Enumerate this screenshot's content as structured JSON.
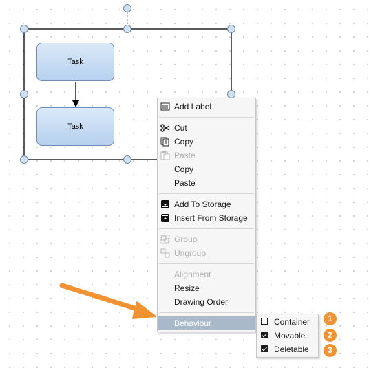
{
  "diagram": {
    "tasks": [
      {
        "label": "Task"
      },
      {
        "label": "Task"
      }
    ]
  },
  "context_menu": {
    "items": [
      {
        "label": "Add Label",
        "icon": "label-icon",
        "enabled": true
      },
      {
        "label": "Cut",
        "icon": "scissors-icon",
        "enabled": true
      },
      {
        "label": "Copy",
        "icon": "copy-icon",
        "enabled": true
      },
      {
        "label": "Paste",
        "icon": "paste-icon",
        "enabled": false
      },
      {
        "label": "Copy",
        "icon": "",
        "enabled": true
      },
      {
        "label": "Paste",
        "icon": "",
        "enabled": true
      },
      {
        "label": "Add To Storage",
        "icon": "storage-add-icon",
        "enabled": true
      },
      {
        "label": "Insert From Storage",
        "icon": "storage-insert-icon",
        "enabled": true
      },
      {
        "label": "Group",
        "icon": "group-icon",
        "enabled": false
      },
      {
        "label": "Ungroup",
        "icon": "ungroup-icon",
        "enabled": false
      },
      {
        "label": "Alignment",
        "icon": "",
        "enabled": false
      },
      {
        "label": "Resize",
        "icon": "",
        "enabled": true
      },
      {
        "label": "Drawing Order",
        "icon": "",
        "enabled": true
      },
      {
        "label": "Behaviour",
        "icon": "",
        "enabled": true,
        "selected": true
      }
    ]
  },
  "submenu": {
    "items": [
      {
        "label": "Container",
        "checked": false
      },
      {
        "label": "Movable",
        "checked": true
      },
      {
        "label": "Deletable",
        "checked": true
      }
    ]
  },
  "badges": [
    "1",
    "2",
    "3"
  ],
  "colors": {
    "accent_orange": "#f39231",
    "selected_item": "#a9b9c9",
    "task_fill": "#c6dcf3",
    "handle_fill": "#cfe0f3"
  }
}
